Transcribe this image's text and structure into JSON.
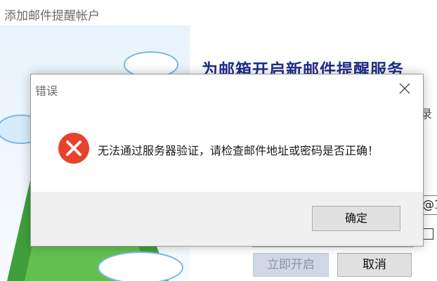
{
  "background_window": {
    "title": "添加邮件提醒帐户",
    "heading": "为邮箱开启新邮件提醒服务",
    "side_text": "录",
    "domain_field_value": "@1",
    "start_button": "立即开启",
    "cancel_button": "取消"
  },
  "error_dialog": {
    "title": "错误",
    "message": "无法通过服务器验证，请检查邮件地址或密码是否正确！",
    "ok_button": "确定",
    "icon": "error-x-icon",
    "icon_color": "#e8412c"
  }
}
